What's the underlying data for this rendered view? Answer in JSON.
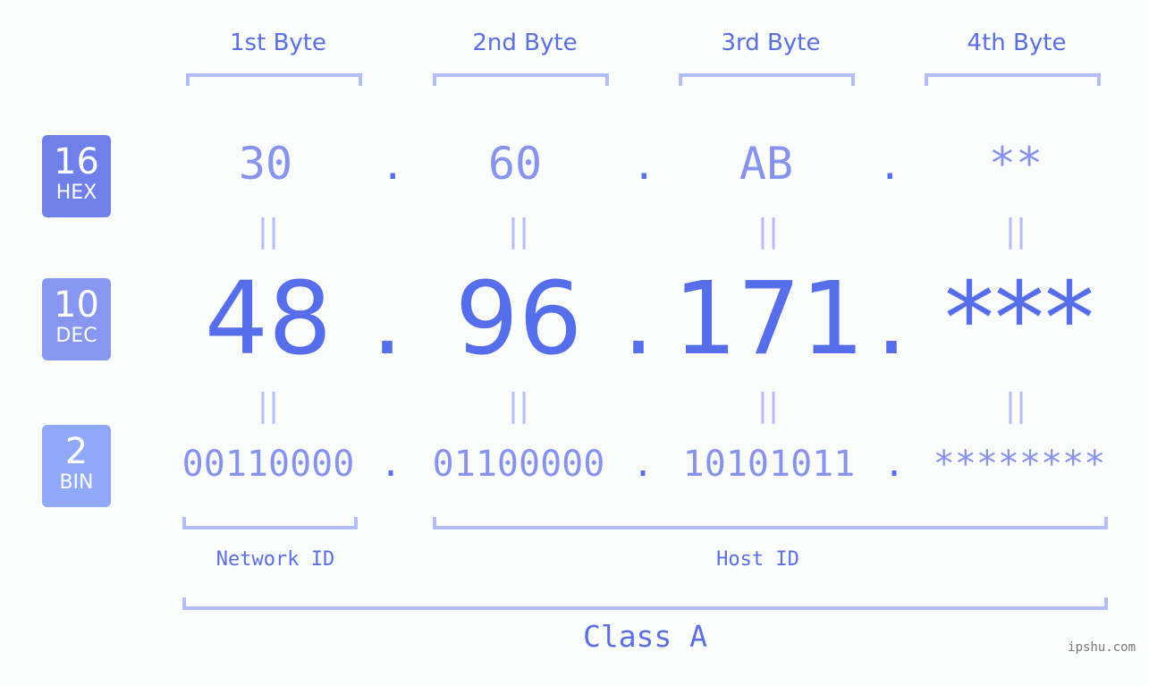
{
  "bases": [
    {
      "num": "16",
      "label": "HEX",
      "color": "#7080ea"
    },
    {
      "num": "10",
      "label": "DEC",
      "color": "#8796ef"
    },
    {
      "num": "2",
      "label": "BIN",
      "color": "#8fa8f7"
    }
  ],
  "bytes": [
    {
      "header": "1st Byte",
      "hex": "30",
      "dec": "48",
      "bin": "00110000"
    },
    {
      "header": "2nd Byte",
      "hex": "60",
      "dec": "96",
      "bin": "01100000"
    },
    {
      "header": "3rd Byte",
      "hex": "AB",
      "dec": "171",
      "bin": "10101011"
    },
    {
      "header": "4th Byte",
      "hex": "**",
      "dec": "***",
      "bin": "********"
    }
  ],
  "separator": ".",
  "equals": "||",
  "network_label": "Network ID",
  "host_label": "Host ID",
  "class_label": "Class A",
  "watermark": "ipshu.com"
}
